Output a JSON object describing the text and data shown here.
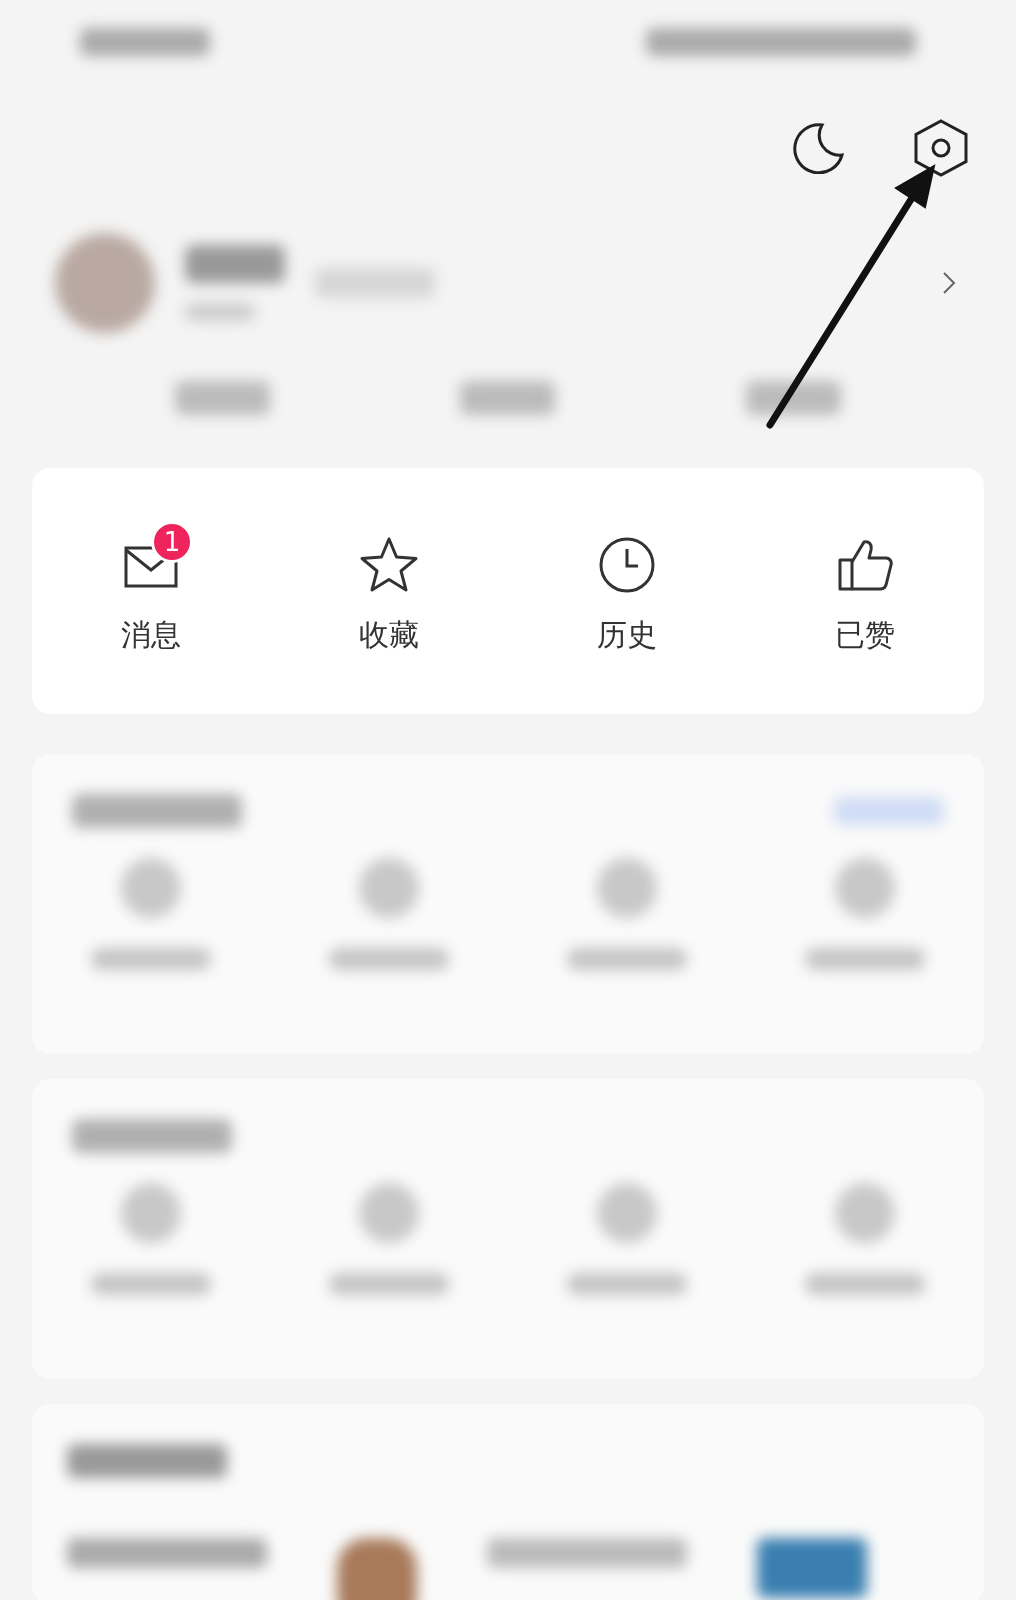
{
  "quick_actions": [
    {
      "label": "消息",
      "badge": "1",
      "kind": "message"
    },
    {
      "label": "收藏",
      "kind": "favorite"
    },
    {
      "label": "历史",
      "kind": "history"
    },
    {
      "label": "已赞",
      "kind": "liked"
    }
  ]
}
